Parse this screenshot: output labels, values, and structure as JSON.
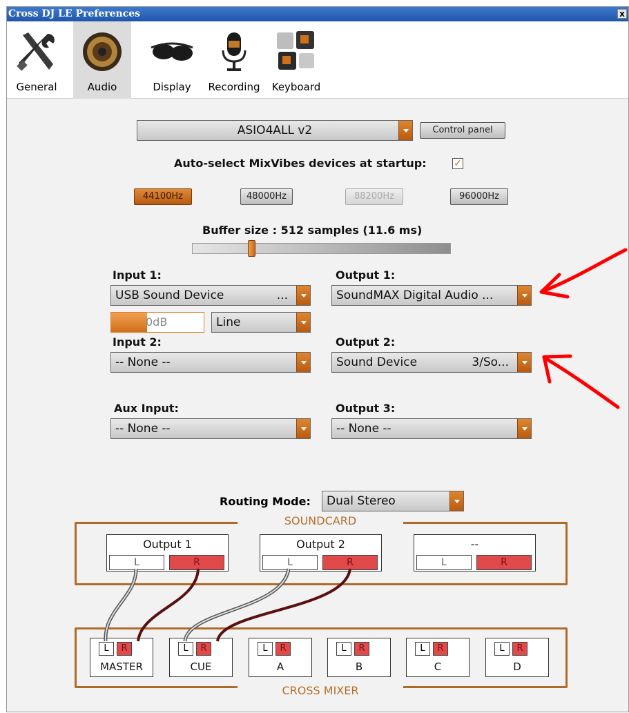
{
  "window": {
    "title": "Cross DJ LE Preferences",
    "close": "x"
  },
  "tabs": [
    {
      "label": "General",
      "icon": "tools-icon"
    },
    {
      "label": "Audio",
      "icon": "speaker-icon"
    },
    {
      "label": "Display",
      "icon": "sunglasses-icon"
    },
    {
      "label": "Recording",
      "icon": "microphone-icon"
    },
    {
      "label": "Keyboard",
      "icon": "keys-icon"
    }
  ],
  "active_tab": "Audio",
  "audio": {
    "driver": "ASIO4ALL v2",
    "control_panel": "Control panel",
    "autoselect_label": "Auto-select MixVibes devices at startup:",
    "autoselect_checked": true,
    "rates": [
      {
        "label": "44100Hz",
        "state": "selected"
      },
      {
        "label": "48000Hz",
        "state": "normal"
      },
      {
        "label": "88200Hz",
        "state": "disabled"
      },
      {
        "label": "96000Hz",
        "state": "normal"
      }
    ],
    "buffer_label": "Buffer size : 512 samples (11.6 ms)",
    "buffer_fraction": 0.23,
    "input1": {
      "label": "Input 1:",
      "device": "USB Sound Device",
      "device_suffix": "...",
      "gain": "0dB",
      "gain_fraction": 0.38,
      "type": "Line"
    },
    "input2": {
      "label": "Input 2:",
      "device": "-- None --"
    },
    "aux": {
      "label": "Aux Input:",
      "device": "-- None --"
    },
    "output1": {
      "label": "Output 1:",
      "device": "SoundMAX Digital Audio ..."
    },
    "output2": {
      "label": "Output 2:",
      "device": "Sound Device",
      "device_suffix": "3/So..."
    },
    "output3": {
      "label": "Output 3:",
      "device": "-- None --"
    },
    "routing_label": "Routing Mode:",
    "routing_mode": "Dual Stereo"
  },
  "soundcard": {
    "title": "SOUNDCARD",
    "outputs": [
      {
        "name": "Output 1",
        "l": "L",
        "r": "R"
      },
      {
        "name": "Output 2",
        "l": "L",
        "r": "R"
      },
      {
        "name": "--",
        "l": "L",
        "r": "R"
      }
    ]
  },
  "mixer": {
    "title": "CROSS MIXER",
    "channels": [
      {
        "name": "MASTER",
        "l": "L",
        "r": "R"
      },
      {
        "name": "CUE",
        "l": "L",
        "r": "R"
      },
      {
        "name": "A",
        "l": "L",
        "r": "R"
      },
      {
        "name": "B",
        "l": "L",
        "r": "R"
      },
      {
        "name": "C",
        "l": "L",
        "r": "R"
      },
      {
        "name": "D",
        "l": "L",
        "r": "R"
      }
    ]
  },
  "colors": {
    "accent": "#d0701a",
    "annotation": "#ff0000",
    "box": "#b06a2a"
  }
}
